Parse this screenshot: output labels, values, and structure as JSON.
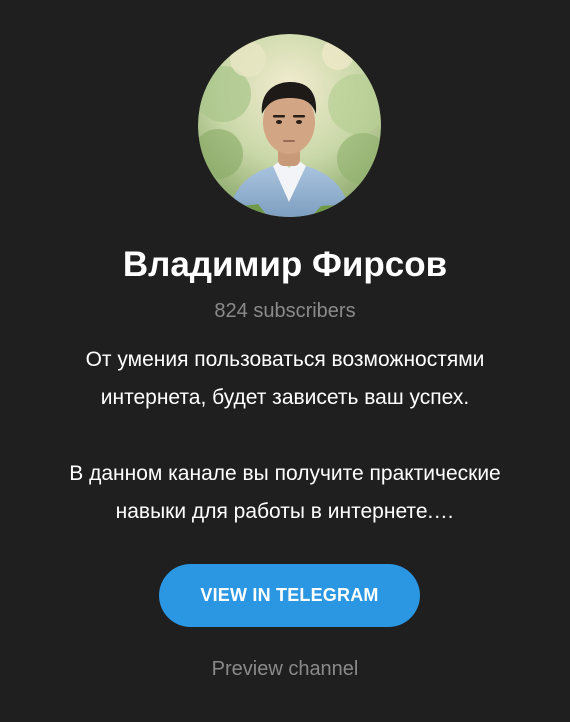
{
  "channel": {
    "title": "Владимир Фирсов",
    "subscribers": "824 subscribers",
    "description_lines": [
      "От умения пользоваться возможностями",
      "интернета, будет зависеть ваш успех.",
      "В данном канале вы получите практические",
      "навыки для работы в интернете.…"
    ]
  },
  "actions": {
    "view_button": "VIEW IN TELEGRAM",
    "preview_link": "Preview channel"
  },
  "colors": {
    "background": "#1f1f1f",
    "accent": "#2b97e3",
    "muted_text": "#8a8a8a"
  },
  "icons": {
    "avatar": "channel-avatar-photo"
  }
}
